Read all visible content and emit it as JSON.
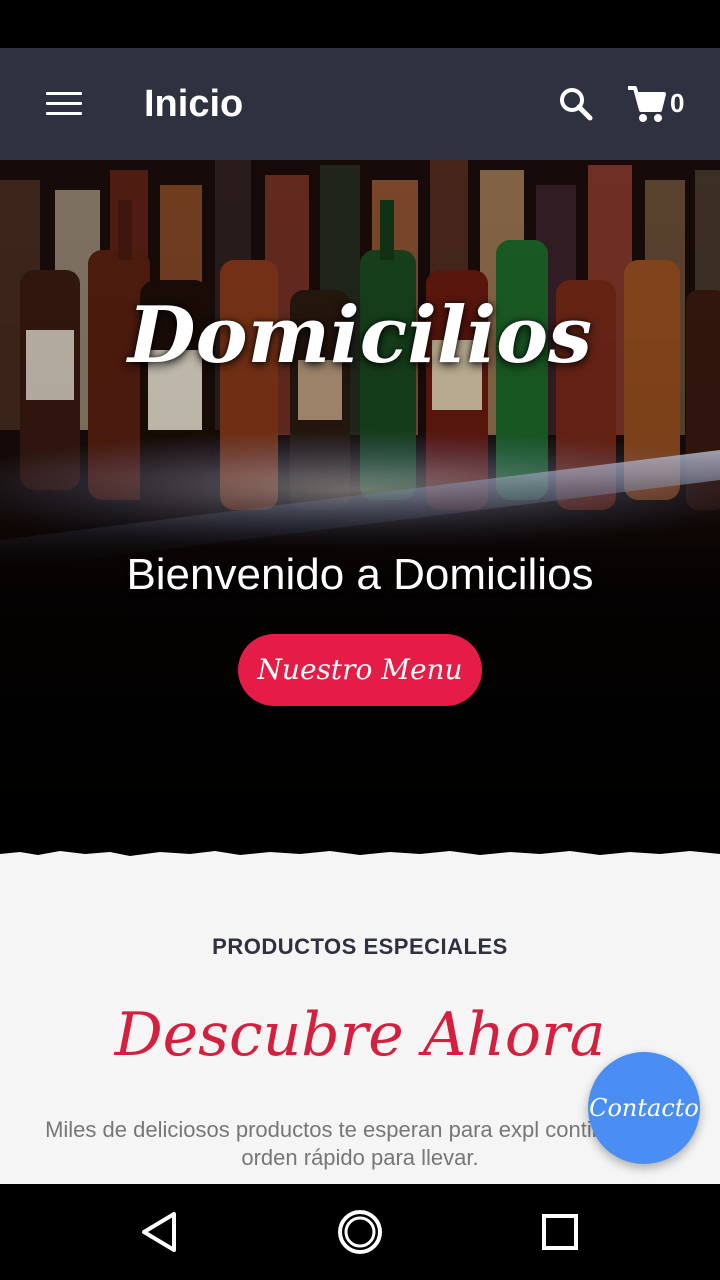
{
  "app_bar": {
    "title": "Inicio",
    "cart_count": "0",
    "icons": [
      "menu-icon",
      "search-icon",
      "cart-icon"
    ]
  },
  "hero": {
    "title": "Domicilios",
    "subtitle": "Bienvenido a Domicilios",
    "button_label": "Nuestro Menu"
  },
  "section": {
    "kicker": "PRODUCTOS ESPECIALES",
    "title": "Descubre Ahora",
    "text": "Miles de deliciosos productos te esperan para expl continuación, orden rápido para llevar."
  },
  "fab": {
    "label": "Contacto"
  },
  "nav": {
    "icons": [
      "back-icon",
      "home-icon",
      "recents-icon"
    ]
  },
  "colors": {
    "app_bar": "#2d3140",
    "accent_red": "#e41c46",
    "title_red": "#d4203f",
    "fab_blue": "#4a8ef3",
    "content_bg": "#f5f5f5"
  }
}
